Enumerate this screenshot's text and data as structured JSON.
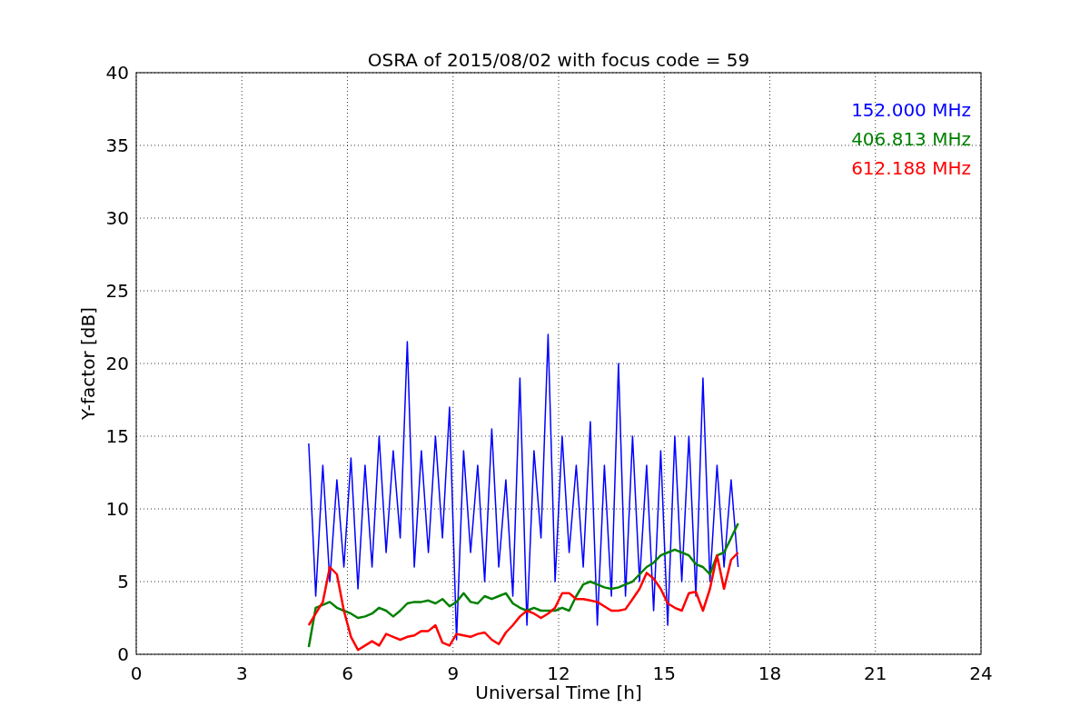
{
  "chart_data": {
    "type": "line",
    "title": "OSRA of 2015/08/02 with focus code = 59",
    "xlabel": "Universal Time [h]",
    "ylabel": "Y-factor [dB]",
    "x": [
      4.9,
      5.1,
      5.3,
      5.5,
      5.7,
      5.9,
      6.1,
      6.3,
      6.5,
      6.7,
      6.9,
      7.1,
      7.3,
      7.5,
      7.7,
      7.9,
      8.1,
      8.3,
      8.5,
      8.7,
      8.9,
      9.1,
      9.3,
      9.5,
      9.7,
      9.9,
      10.1,
      10.3,
      10.5,
      10.7,
      10.9,
      11.1,
      11.3,
      11.5,
      11.7,
      11.9,
      12.1,
      12.3,
      12.5,
      12.7,
      12.9,
      13.1,
      13.3,
      13.5,
      13.7,
      13.9,
      14.1,
      14.3,
      14.5,
      14.7,
      14.9,
      15.1,
      15.3,
      15.5,
      15.7,
      15.9,
      16.1,
      16.3,
      16.5,
      16.7,
      16.9,
      17.1
    ],
    "series": [
      {
        "name": "152.000 MHz",
        "color": "#0000ff",
        "values": [
          14.5,
          4,
          13,
          5,
          12,
          6,
          13.5,
          4.5,
          13,
          6,
          15,
          7,
          14,
          8,
          21.5,
          6,
          14,
          7,
          15,
          8,
          17,
          1,
          14,
          7,
          13,
          5,
          15.5,
          6,
          12,
          4,
          19,
          2,
          14,
          8,
          22,
          5,
          15,
          7,
          13,
          6,
          16,
          2,
          13,
          4,
          20,
          4,
          15,
          5,
          13,
          3,
          14,
          2,
          15,
          5,
          15,
          4,
          19,
          5,
          13,
          6,
          12,
          6
        ]
      },
      {
        "name": "406.813 MHz",
        "color": "#008000",
        "values": [
          0.5,
          3.2,
          3.4,
          3.6,
          3.2,
          3.0,
          2.8,
          2.5,
          2.6,
          2.8,
          3.2,
          3.0,
          2.6,
          3.0,
          3.5,
          3.6,
          3.6,
          3.7,
          3.5,
          3.8,
          3.3,
          3.6,
          4.2,
          3.6,
          3.5,
          4.0,
          3.8,
          4.0,
          4.2,
          3.5,
          3.2,
          3.0,
          3.2,
          3.0,
          3.0,
          3.0,
          3.2,
          3.0,
          4.0,
          4.8,
          5.0,
          4.8,
          4.6,
          4.5,
          4.6,
          4.8,
          5.0,
          5.5,
          6.0,
          6.3,
          6.8,
          7.0,
          7.2,
          7.0,
          6.8,
          6.2,
          6.0,
          5.5,
          6.8,
          7.0,
          8.0,
          9.0
        ]
      },
      {
        "name": "612.188 MHz",
        "color": "#ff0000",
        "values": [
          2.0,
          2.8,
          3.6,
          6.0,
          5.5,
          3.0,
          1.2,
          0.3,
          0.6,
          0.9,
          0.6,
          1.4,
          1.2,
          1.0,
          1.2,
          1.3,
          1.6,
          1.6,
          2.0,
          0.8,
          0.6,
          1.4,
          1.3,
          1.2,
          1.4,
          1.5,
          1.0,
          0.7,
          1.5,
          2.0,
          2.6,
          3.0,
          2.8,
          2.5,
          2.8,
          3.2,
          4.2,
          4.2,
          3.8,
          3.8,
          3.7,
          3.6,
          3.3,
          3.0,
          3.0,
          3.1,
          3.8,
          4.5,
          5.6,
          5.2,
          4.5,
          3.5,
          3.2,
          3.0,
          4.2,
          4.3,
          3.0,
          4.5,
          6.8,
          4.5,
          6.5,
          7.0
        ]
      }
    ],
    "grid": true,
    "xlim": [
      0,
      24
    ],
    "ylim": [
      0,
      40
    ],
    "xticks": [
      0,
      3,
      6,
      9,
      12,
      15,
      18,
      21,
      24
    ],
    "yticks": [
      0,
      5,
      10,
      15,
      20,
      25,
      30,
      35,
      40
    ]
  }
}
